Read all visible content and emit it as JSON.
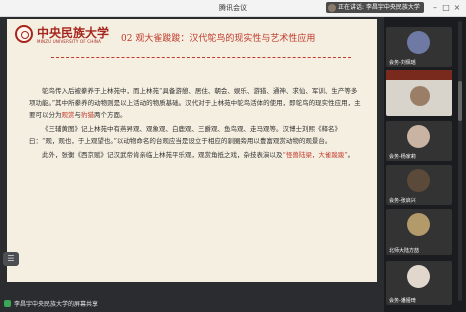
{
  "window": {
    "title": "腾讯会议",
    "speaking_label": "正在讲话: 李昌宇中央民族大学"
  },
  "slide": {
    "logo_cn": "中央民族大学",
    "logo_en": "MINZU UNIVERSITY OF CHINA",
    "title": "02 观大雀踆踆：汉代鸵鸟的现实性与艺术性应用",
    "p1": "鸵鸟传入后被豢养于上林苑中，而上林苑“具备游憩、居住、朝会、娱乐、游猎、通神、求仙、军训、生产等多项功能。”其中所豢养的动物则是以上活动的物质基础。汉代对于上林苑中鸵鸟活体的使用，即鸵鸟的现实性应用，主要可以分为",
    "p1_hl1": "观赏",
    "p1_mid": "与",
    "p1_hl2": "豹猎",
    "p1_end": "两个方面。",
    "p2": "《三辅黄图》记上林苑中有燕昇观、观象观、白鹿观、三爵观、鱼鸟观、走马观等。汉博士刘熙《释名》曰：“观，观也，于上观望也。”以动物命名的台观应当是设立于相应的驯圈旁用以豊富观赏动物的观景台。",
    "p3": "此外，张衡《西京赋》记汉武帝肯亲临上林苑平乐观，观赏角抵之戏，杂技表演以及",
    "p3_hl": "“怪兽陆梁，大雀踆踆”",
    "p3_end": "。"
  },
  "bottom": {
    "share_label": "李昌宇中央民族大学的屏幕共享"
  },
  "participants": [
    {
      "name": "会务-刘佩瑶"
    },
    {
      "name": ""
    },
    {
      "name": "会务-杨家莉"
    },
    {
      "name": "会务-张启兴"
    },
    {
      "name": "北师大陆方喆"
    },
    {
      "name": "会务-潘娅琦"
    }
  ]
}
